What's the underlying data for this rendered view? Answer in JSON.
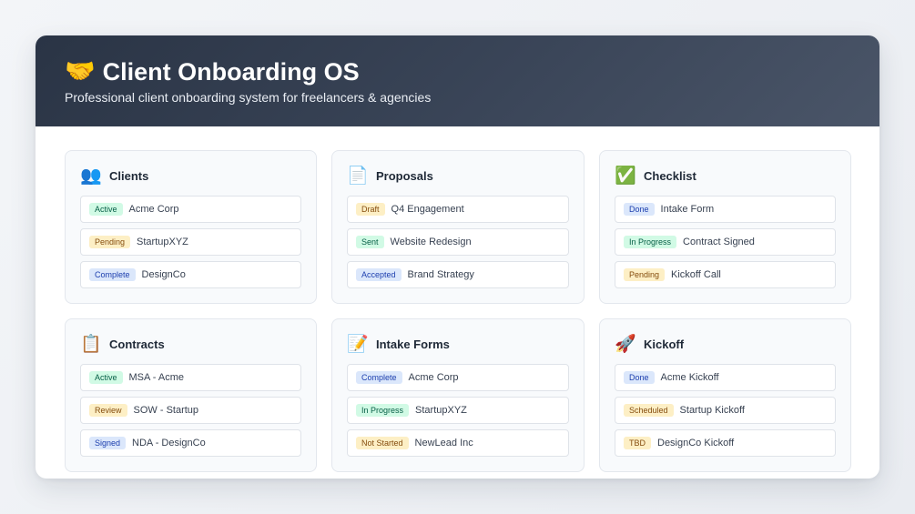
{
  "header": {
    "icon": "handshake-icon",
    "emoji": "🤝",
    "title": "Client Onboarding OS",
    "subtitle": "Professional client onboarding system for freelancers & agencies"
  },
  "colors": {
    "header_start": "#2a3445",
    "header_end": "#4a5568",
    "badge_green_bg": "#d1fae5",
    "badge_green_text": "#065f46",
    "badge_yellow_bg": "#fdefc5",
    "badge_yellow_text": "#854d0e",
    "badge_blue_bg": "#dbe7fb",
    "badge_blue_text": "#1e40af"
  },
  "cards": [
    {
      "icon": "people-icon",
      "emoji": "👥",
      "title": "Clients",
      "items": [
        {
          "status": "Active",
          "color": "green",
          "label": "Acme Corp"
        },
        {
          "status": "Pending",
          "color": "yellow",
          "label": "StartupXYZ"
        },
        {
          "status": "Complete",
          "color": "blue",
          "label": "DesignCo"
        }
      ]
    },
    {
      "icon": "document-icon",
      "emoji": "📄",
      "title": "Proposals",
      "items": [
        {
          "status": "Draft",
          "color": "yellow",
          "label": "Q4 Engagement"
        },
        {
          "status": "Sent",
          "color": "green",
          "label": "Website Redesign"
        },
        {
          "status": "Accepted",
          "color": "blue",
          "label": "Brand Strategy"
        }
      ]
    },
    {
      "icon": "check-mark-icon",
      "emoji": "✅",
      "title": "Checklist",
      "items": [
        {
          "status": "Done",
          "color": "blue",
          "label": "Intake Form"
        },
        {
          "status": "In Progress",
          "color": "green",
          "label": "Contract Signed"
        },
        {
          "status": "Pending",
          "color": "yellow",
          "label": "Kickoff Call"
        }
      ]
    },
    {
      "icon": "clipboard-icon",
      "emoji": "📋",
      "title": "Contracts",
      "items": [
        {
          "status": "Active",
          "color": "green",
          "label": "MSA - Acme"
        },
        {
          "status": "Review",
          "color": "yellow",
          "label": "SOW - Startup"
        },
        {
          "status": "Signed",
          "color": "blue",
          "label": "NDA - DesignCo"
        }
      ]
    },
    {
      "icon": "memo-icon",
      "emoji": "📝",
      "title": "Intake Forms",
      "items": [
        {
          "status": "Complete",
          "color": "blue",
          "label": "Acme Corp"
        },
        {
          "status": "In Progress",
          "color": "green",
          "label": "StartupXYZ"
        },
        {
          "status": "Not Started",
          "color": "yellow",
          "label": "NewLead Inc"
        }
      ]
    },
    {
      "icon": "rocket-icon",
      "emoji": "🚀",
      "title": "Kickoff",
      "items": [
        {
          "status": "Done",
          "color": "blue",
          "label": "Acme Kickoff"
        },
        {
          "status": "Scheduled",
          "color": "yellow",
          "label": "Startup Kickoff"
        },
        {
          "status": "TBD",
          "color": "yellow",
          "label": "DesignCo Kickoff"
        }
      ]
    }
  ]
}
